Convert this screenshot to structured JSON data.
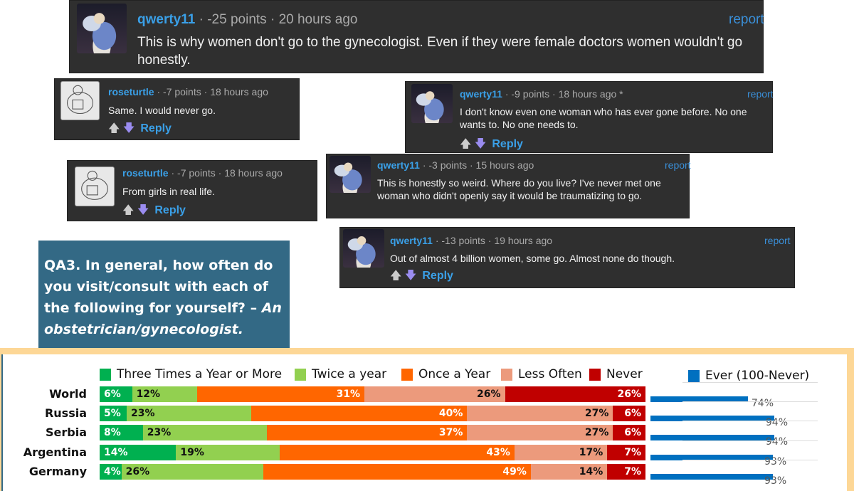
{
  "comments": [
    {
      "user": "qwerty11",
      "points": "-25 points",
      "time": "20 hours ago",
      "report": "report",
      "text": "This is why women don't go to the gynecologist. Even if they were female doctors women wouldn't go honestly.",
      "avatar": "angel",
      "reply": ""
    },
    {
      "user": "roseturtle",
      "points": "-7 points",
      "time": "18 hours ago",
      "report": "",
      "text": "Same. I would never go.",
      "avatar": "turtle",
      "reply": "Reply"
    },
    {
      "user": "qwerty11",
      "points": "-9 points",
      "time": "18 hours ago *",
      "report": "report",
      "text": "I don't know even one woman who has ever gone before. No one wants to. No one needs to.",
      "avatar": "angel",
      "reply": "Reply"
    },
    {
      "user": "roseturtle",
      "points": "-7 points",
      "time": "18 hours ago",
      "report": "",
      "text": "From girls in real life.",
      "avatar": "turtle",
      "reply": "Reply"
    },
    {
      "user": "qwerty11",
      "points": "-3 points",
      "time": "15 hours ago",
      "report": "report",
      "text": "This is honestly so weird. Where do you live? I've never met one woman who didn't openly say it would be traumatizing to go.",
      "avatar": "angel",
      "reply": ""
    },
    {
      "user": "qwerty11",
      "points": "-13 points",
      "time": "19 hours ago",
      "report": "report",
      "text": "Out of almost 4 billion women, some go. Almost none do though.",
      "avatar": "angel",
      "reply": "Reply"
    }
  ],
  "question": {
    "text": "QA3. In general, how often do you visit/consult with each of the following for yourself? – ",
    "italic": "An obstetrician/gynecologist."
  },
  "chart_data": [
    {
      "type": "bar",
      "orientation": "horizontal",
      "stacked": true,
      "categories": [
        "World",
        "Russia",
        "Serbia",
        "Argentina",
        "Germany"
      ],
      "series": [
        {
          "name": "Three Times a Year or More",
          "color": "#00b050",
          "values": [
            6,
            5,
            8,
            14,
            4
          ]
        },
        {
          "name": "Twice a year",
          "color": "#92d050",
          "values": [
            12,
            23,
            23,
            19,
            26
          ]
        },
        {
          "name": "Once a Year",
          "color": "#ff6600",
          "values": [
            31,
            40,
            37,
            43,
            49
          ]
        },
        {
          "name": "Less Often",
          "color": "#ec9a7c",
          "values": [
            26,
            27,
            27,
            17,
            14
          ]
        },
        {
          "name": "Never",
          "color": "#c00000",
          "values": [
            26,
            6,
            6,
            7,
            7
          ]
        }
      ],
      "xlim": [
        0,
        100
      ],
      "legend": "top"
    },
    {
      "type": "bar",
      "orientation": "horizontal",
      "categories": [
        "World",
        "Russia",
        "Serbia",
        "Argentina",
        "Germany"
      ],
      "series": [
        {
          "name": "Ever (100-Never)",
          "color": "#0070c0",
          "values": [
            74,
            94,
            94,
            93,
            93
          ]
        }
      ],
      "xlim": [
        0,
        100
      ],
      "grid": true
    }
  ]
}
